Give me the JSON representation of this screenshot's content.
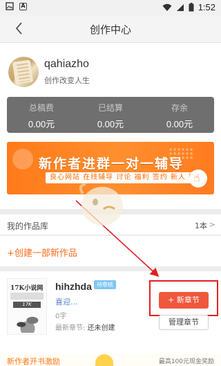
{
  "statusbar": {
    "time": "1:52",
    "left_icons": [
      "image-icon",
      "a-icon"
    ],
    "right_icons": [
      "wifi-icon",
      "signal-icon",
      "battery-icon"
    ]
  },
  "navbar": {
    "title": "创作中心",
    "back_icon": "chevron-left-icon"
  },
  "profile": {
    "username": "qahiazho",
    "motto": "创作改变人生"
  },
  "stats": [
    {
      "label": "总稿费",
      "value": "0.00元"
    },
    {
      "label": "已结算",
      "value": "0.00元"
    },
    {
      "label": "存余",
      "value": "0.00元"
    }
  ],
  "banner": {
    "title": "新作者进群一对一辅导",
    "subtitle": "良心网站 在线辅导 讨论 福利 签约 新人 能",
    "icon": "pointing-hand-icon",
    "colors": {
      "background": "#ff7a1a"
    }
  },
  "works": {
    "section_title": "我的作品库",
    "count_label": "1本",
    "arrow": ">",
    "create_label": "+创建一部新作品",
    "items": [
      {
        "cover_brand": "17K小说网",
        "cover_logo": "17K",
        "title": "hihzhda",
        "badge": "待审核",
        "description": "喜迎…",
        "words": "0字",
        "latest_label": "最新章节:",
        "latest_value": "还未创建",
        "new_chapter_label": "+ 新章节",
        "manage_label": "管理章节"
      }
    ]
  },
  "bottom_promo": {
    "left": "新作者开书激励",
    "right": "最高100元现金奖励"
  },
  "colors": {
    "accent": "#ff6a1a",
    "new_chapter_button": "#f0583c",
    "highlight": "#e21e1e",
    "stats_panel": "#6f6f6f"
  }
}
